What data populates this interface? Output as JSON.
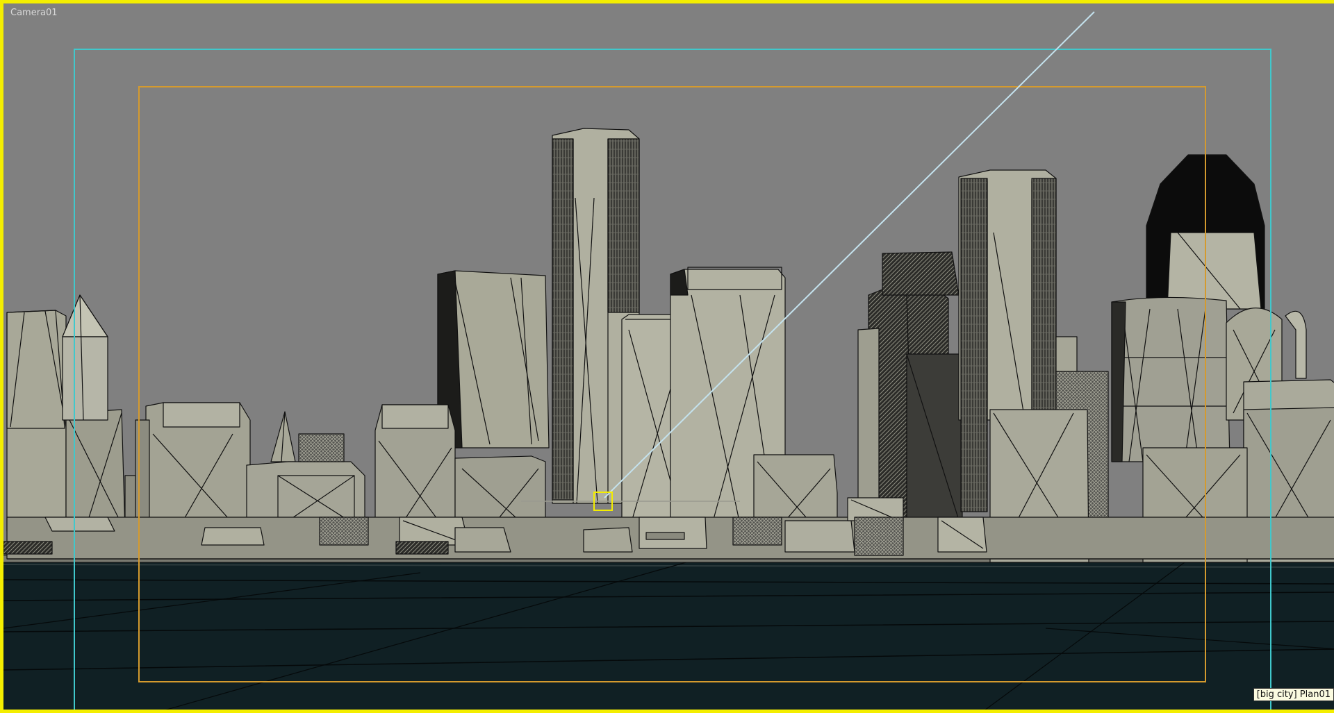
{
  "viewport": {
    "label": "Camera01",
    "tooltip": "[big city] Plan01"
  },
  "colors": {
    "active_viewport_border": "#f4ee00",
    "safe_frame_action": "#40c8cc",
    "safe_frame_title": "#d49a2e",
    "background": "#808080",
    "ground": "#102024",
    "building_fill": "#a8a898",
    "building_shadow": "#3a3a36",
    "edge": "#101010",
    "camera_target_line": "#c4e2ee",
    "selection_marker": "#f4ee00"
  }
}
